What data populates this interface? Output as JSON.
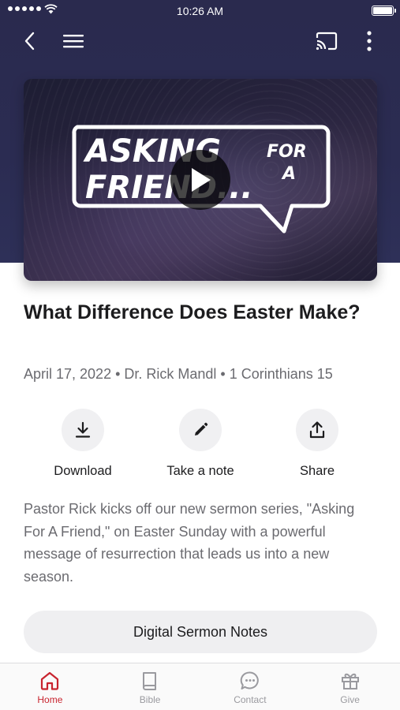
{
  "status_bar": {
    "time": "10:26 AM"
  },
  "nav": {
    "back_icon": "chevron-left-icon",
    "menu_icon": "hamburger-menu-icon",
    "cast_icon": "cast-icon",
    "more_icon": "more-vertical-icon"
  },
  "video": {
    "logo_line1": "ASKING",
    "logo_line2": "FRIEND...",
    "logo_for": "FOR",
    "logo_a": "A",
    "play_icon": "play-icon"
  },
  "sermon": {
    "title": "What Difference Does Easter Make?",
    "meta": "April 17, 2022 • Dr. Rick Mandl • 1 Corinthians 15",
    "description": "Pastor Rick kicks off our new sermon series, \"Asking For A Friend,\" on Easter Sunday with a powerful message of resurrection that leads us into a new season."
  },
  "actions": {
    "download": "Download",
    "take_note": "Take a note",
    "share": "Share"
  },
  "notes_button": "Digital Sermon Notes",
  "tabs": [
    {
      "label": "Home",
      "icon": "home-icon",
      "active": true
    },
    {
      "label": "Bible",
      "icon": "book-icon",
      "active": false
    },
    {
      "label": "Contact",
      "icon": "chat-bubble-icon",
      "active": false
    },
    {
      "label": "Give",
      "icon": "gift-icon",
      "active": false
    }
  ],
  "colors": {
    "accent": "#c8242f",
    "hero_bg": "#2b2c52",
    "button_bg": "#efeff1"
  }
}
